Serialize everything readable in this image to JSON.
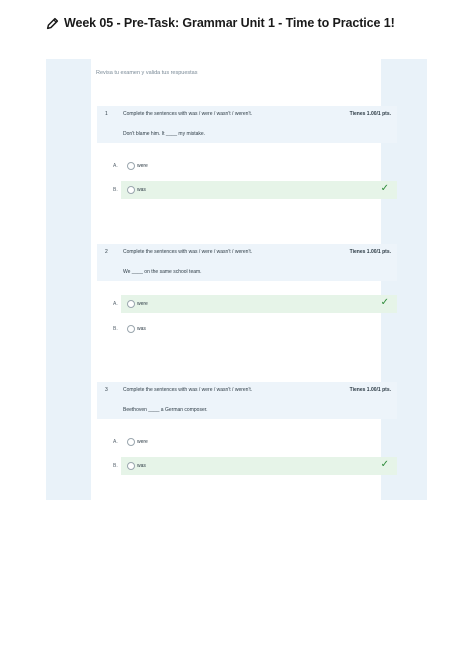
{
  "page": {
    "title": "Week 05 - Pre-Task: Grammar Unit 1 - Time to Practice 1!",
    "instructions": "Revisa tu examen y valida tus respuestas"
  },
  "questions": [
    {
      "number": "1",
      "prompt": "Complete the sentences with was / were / wasn't / weren't.",
      "points": "Tienes 1.00/1 pts.",
      "text": "Don't blame him. It ____ my mistake.",
      "options": [
        {
          "letter": "A.",
          "text": "were",
          "correct": false
        },
        {
          "letter": "B.",
          "text": "was",
          "correct": true
        }
      ]
    },
    {
      "number": "2",
      "prompt": "Complete the sentences with was / were / wasn't / weren't.",
      "points": "Tienes 1.00/1 pts.",
      "text": "We ____ on the same school team.",
      "options": [
        {
          "letter": "A.",
          "text": "were",
          "correct": true
        },
        {
          "letter": "B.",
          "text": "was",
          "correct": false
        }
      ]
    },
    {
      "number": "3",
      "prompt": "Complete the sentences with was / were / wasn't / weren't.",
      "points": "Tienes 1.00/1 pts.",
      "text": "Beethoven ____ a German composer.",
      "options": [
        {
          "letter": "A.",
          "text": "were",
          "correct": false
        },
        {
          "letter": "B.",
          "text": "was",
          "correct": true
        }
      ]
    }
  ],
  "icons": {
    "title_icon": "pencil-icon",
    "correct_icon": "checkmark-icon"
  },
  "colors": {
    "frame": "#e9f2f9",
    "question_header": "#edf4fa",
    "correct_bg": "#e6f4e8",
    "check": "#2e8b3a"
  }
}
